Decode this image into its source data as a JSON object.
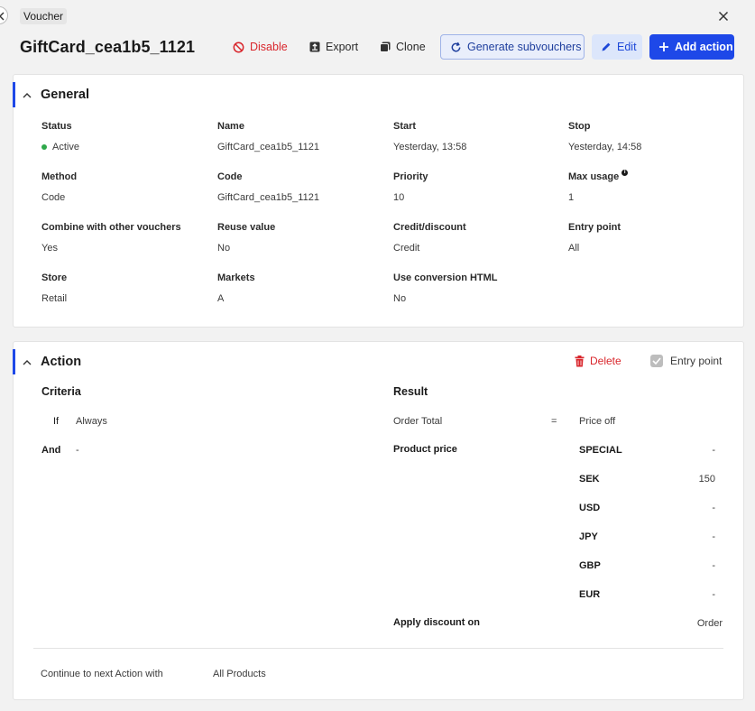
{
  "breadcrumb": {
    "label": "Voucher"
  },
  "header": {
    "title": "GiftCard_cea1b5_1121"
  },
  "toolbar": {
    "disable": "Disable",
    "export": "Export",
    "clone": "Clone",
    "generate": "Generate subvouchers",
    "edit": "Edit",
    "add_action": "Add action"
  },
  "general": {
    "title": "General",
    "fields": {
      "status": {
        "label": "Status",
        "value": "Active"
      },
      "name": {
        "label": "Name",
        "value": "GiftCard_cea1b5_1121"
      },
      "start": {
        "label": "Start",
        "value": "Yesterday, 13:58"
      },
      "stop": {
        "label": "Stop",
        "value": "Yesterday, 14:58"
      },
      "method": {
        "label": "Method",
        "value": "Code"
      },
      "code": {
        "label": "Code",
        "value": "GiftCard_cea1b5_1121"
      },
      "priority": {
        "label": "Priority",
        "value": "10"
      },
      "max_usage": {
        "label": "Max usage",
        "value": "1"
      },
      "combine": {
        "label": "Combine with other vouchers",
        "value": "Yes"
      },
      "reuse": {
        "label": "Reuse value",
        "value": "No"
      },
      "credit": {
        "label": "Credit/discount",
        "value": "Credit"
      },
      "entry": {
        "label": "Entry point",
        "value": "All"
      },
      "store": {
        "label": "Store",
        "value": "Retail"
      },
      "markets": {
        "label": "Markets",
        "value": "A"
      },
      "conversion": {
        "label": "Use conversion HTML",
        "value": "No"
      }
    }
  },
  "action": {
    "title": "Action",
    "delete": "Delete",
    "entry_point": "Entry point",
    "criteria": {
      "title": "Criteria",
      "if_label": "If",
      "if_value": "Always",
      "and_label": "And",
      "and_value": "-"
    },
    "result": {
      "title": "Result",
      "order_total": "Order Total",
      "equals": "=",
      "price_off": "Price off",
      "product_price": "Product price",
      "currencies": [
        {
          "code": "SPECIAL",
          "value": "-"
        },
        {
          "code": "SEK",
          "value": "150"
        },
        {
          "code": "USD",
          "value": "-"
        },
        {
          "code": "JPY",
          "value": "-"
        },
        {
          "code": "GBP",
          "value": "-"
        },
        {
          "code": "EUR",
          "value": "-"
        }
      ],
      "apply_label": "Apply discount on",
      "apply_value": "Order"
    },
    "continue_label": "Continue to next Action with",
    "continue_value": "All Products"
  },
  "colors": {
    "accent": "#1e48e8",
    "danger": "#d9262c",
    "success": "#2ea84a"
  }
}
